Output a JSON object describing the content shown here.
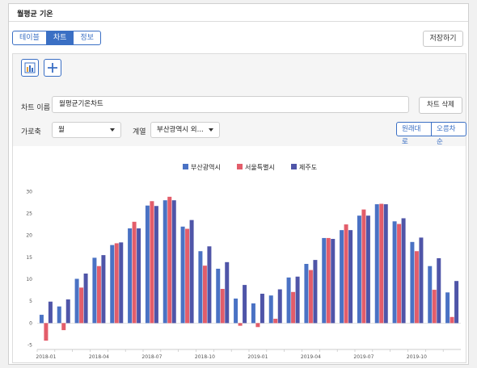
{
  "title": "월평균 기온",
  "view_tabs": [
    {
      "label": "테이블",
      "active": false
    },
    {
      "label": "차트",
      "active": true
    },
    {
      "label": "정보",
      "active": false
    }
  ],
  "save_label": "저장하기",
  "toolbar": {
    "chart_icon": "bar-chart-icon",
    "add_icon": "plus-icon"
  },
  "chart_name": {
    "label": "차트 이름",
    "value": "월평균기온차트"
  },
  "delete_label": "차트 삭제",
  "x_axis": {
    "label": "가로축",
    "value": "월"
  },
  "series_select": {
    "label": "계열",
    "value": "부산광역시 외..."
  },
  "sort": {
    "original": "원래대로",
    "ascending": "오름차순"
  },
  "colors": {
    "accent": "#3a6fc4",
    "busan": "#4a72c4",
    "seoul": "#e35d6a",
    "jeju": "#4f55a8"
  },
  "chart_data": {
    "type": "bar",
    "title": "",
    "xlabel": "",
    "ylabel": "",
    "ylim": [
      -6,
      33
    ],
    "yticks": [
      -5,
      0,
      5,
      10,
      15,
      20,
      25,
      30
    ],
    "xticks": [
      "2018-01",
      "2018-04",
      "2018-07",
      "2018-10",
      "2019-01",
      "2019-04",
      "2019-07",
      "2019-10"
    ],
    "xtick_every": 3,
    "legend_position": "top",
    "grid": false,
    "categories": [
      "2018-01",
      "2018-02",
      "2018-03",
      "2018-04",
      "2018-05",
      "2018-06",
      "2018-07",
      "2018-08",
      "2018-09",
      "2018-10",
      "2018-11",
      "2018-12",
      "2019-01",
      "2019-02",
      "2019-03",
      "2019-04",
      "2019-05",
      "2019-06",
      "2019-07",
      "2019-08",
      "2019-09",
      "2019-10",
      "2019-11",
      "2019-12"
    ],
    "series": [
      {
        "name": "부산광역시",
        "values": [
          1.9,
          3.8,
          10.1,
          14.9,
          17.8,
          21.6,
          26.8,
          28.0,
          22.0,
          16.4,
          12.4,
          5.6,
          4.5,
          6.3,
          10.4,
          13.5,
          19.4,
          21.2,
          24.5,
          27.1,
          23.2,
          18.5,
          13.0,
          7.0
        ]
      },
      {
        "name": "서울특별시",
        "values": [
          -4.0,
          -1.6,
          8.1,
          13.0,
          18.2,
          23.1,
          27.8,
          28.8,
          21.5,
          13.1,
          7.8,
          -0.6,
          -0.9,
          1.0,
          7.1,
          12.1,
          19.4,
          22.5,
          25.9,
          27.2,
          22.6,
          16.4,
          7.6,
          1.4
        ]
      },
      {
        "name": "제주도",
        "values": [
          4.9,
          5.4,
          11.3,
          15.5,
          18.4,
          21.6,
          26.7,
          28.0,
          23.5,
          17.5,
          13.9,
          8.7,
          6.7,
          7.7,
          10.6,
          14.4,
          19.2,
          21.2,
          24.5,
          27.1,
          23.9,
          19.5,
          14.8,
          9.6
        ]
      }
    ]
  }
}
